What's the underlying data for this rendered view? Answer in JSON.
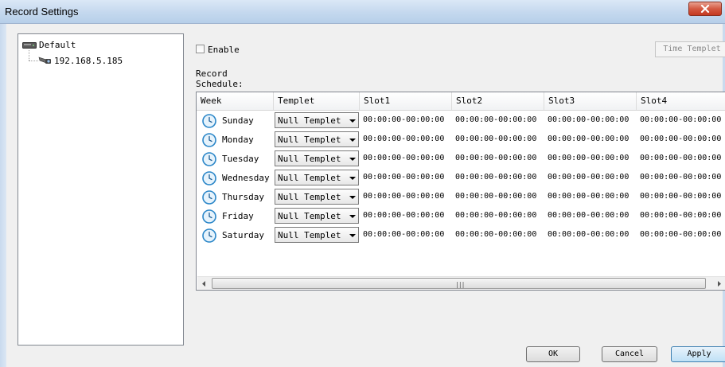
{
  "window": {
    "title": "Record Settings"
  },
  "tree": {
    "root": {
      "label": "Default",
      "icon": "device-icon"
    },
    "children": [
      {
        "label": "192.168.5.185",
        "icon": "camera-icon"
      }
    ]
  },
  "enable": {
    "label": "Enable",
    "checked": false
  },
  "time_templet_button": "Time Templet",
  "schedule_label": "Record Schedule:",
  "table": {
    "columns": [
      "Week",
      "Templet",
      "Slot1",
      "Slot2",
      "Slot3",
      "Slot4"
    ],
    "rows": [
      {
        "week": "Sunday",
        "templet": "Null Templet",
        "slots": [
          "00:00:00-00:00:00",
          "00:00:00-00:00:00",
          "00:00:00-00:00:00",
          "00:00:00-00:00:00"
        ]
      },
      {
        "week": "Monday",
        "templet": "Null Templet",
        "slots": [
          "00:00:00-00:00:00",
          "00:00:00-00:00:00",
          "00:00:00-00:00:00",
          "00:00:00-00:00:00"
        ]
      },
      {
        "week": "Tuesday",
        "templet": "Null Templet",
        "slots": [
          "00:00:00-00:00:00",
          "00:00:00-00:00:00",
          "00:00:00-00:00:00",
          "00:00:00-00:00:00"
        ]
      },
      {
        "week": "Wednesday",
        "templet": "Null Templet",
        "slots": [
          "00:00:00-00:00:00",
          "00:00:00-00:00:00",
          "00:00:00-00:00:00",
          "00:00:00-00:00:00"
        ]
      },
      {
        "week": "Thursday",
        "templet": "Null Templet",
        "slots": [
          "00:00:00-00:00:00",
          "00:00:00-00:00:00",
          "00:00:00-00:00:00",
          "00:00:00-00:00:00"
        ]
      },
      {
        "week": "Friday",
        "templet": "Null Templet",
        "slots": [
          "00:00:00-00:00:00",
          "00:00:00-00:00:00",
          "00:00:00-00:00:00",
          "00:00:00-00:00:00"
        ]
      },
      {
        "week": "Saturday",
        "templet": "Null Templet",
        "slots": [
          "00:00:00-00:00:00",
          "00:00:00-00:00:00",
          "00:00:00-00:00:00",
          "00:00:00-00:00:00"
        ]
      }
    ]
  },
  "buttons": {
    "ok": "OK",
    "cancel": "Cancel",
    "apply": "Apply"
  },
  "colors": {
    "clock_ring": "#2a86c8",
    "clock_face": "#e6f3fc",
    "close_button": "#c94a33"
  }
}
